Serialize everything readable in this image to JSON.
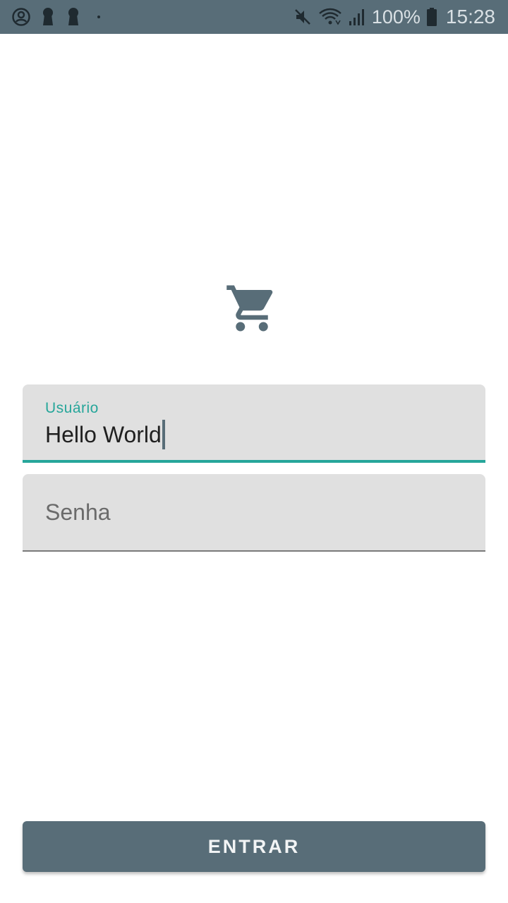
{
  "status_bar": {
    "battery_percent": "100%",
    "time": "15:28",
    "icons": [
      "account-circle-icon",
      "keyhole-icon",
      "keyhole-icon",
      "dot-icon",
      "mute-icon",
      "wifi-icon",
      "signal-icon",
      "battery-icon"
    ],
    "background_color": "#586d78"
  },
  "logo": {
    "icon": "shopping-cart-icon",
    "color": "#586d78"
  },
  "form": {
    "user_field": {
      "label": "Usuário",
      "value": "Hello World",
      "focused": true,
      "accent_color": "#26a69a"
    },
    "password_field": {
      "placeholder": "Senha",
      "value": ""
    }
  },
  "actions": {
    "enter_label": "ENTRAR",
    "button_color": "#586d78"
  }
}
